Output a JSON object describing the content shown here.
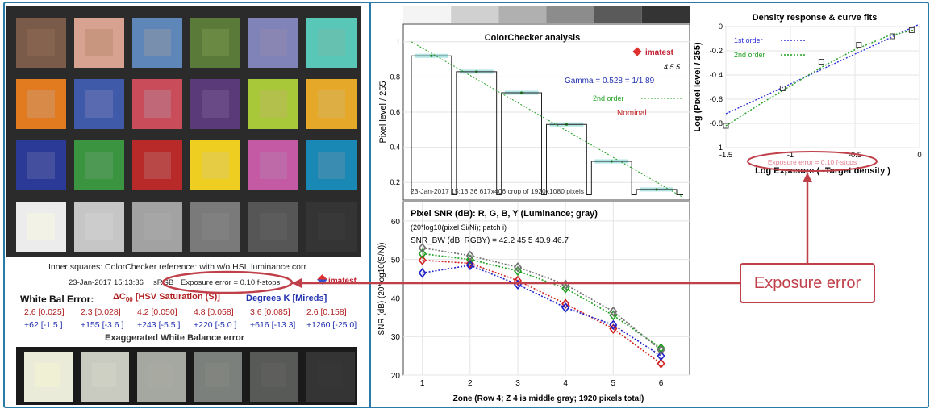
{
  "colors": {
    "accent": "#2a7aa8",
    "callout": "#c0404a",
    "wb_red": "#b02020",
    "wb_blue": "#2030b0"
  },
  "checker": {
    "rows": [
      [
        [
          "#7a5a48",
          "#86634e"
        ],
        [
          "#d7a390",
          "#c8957e"
        ],
        [
          "#5f86b8",
          "#7890ae"
        ],
        [
          "#5a7a3a",
          "#6a8a44"
        ],
        [
          "#7f83b8",
          "#8a86b4"
        ],
        [
          "#58c7b8",
          "#66c1b0"
        ]
      ],
      [
        [
          "#e27a20",
          "#d88a48"
        ],
        [
          "#3e5aa8",
          "#5a6ab0"
        ],
        [
          "#c84c5a",
          "#c06878"
        ],
        [
          "#5a3a78",
          "#6a4a86"
        ],
        [
          "#a8c83a",
          "#b4c04c"
        ],
        [
          "#e6a828",
          "#dcae44"
        ]
      ],
      [
        [
          "#2a3a96",
          "#44509e"
        ],
        [
          "#3a9440",
          "#4e9a54"
        ],
        [
          "#b82a2a",
          "#b84848"
        ],
        [
          "#eece20",
          "#e6cc44"
        ],
        [
          "#c45aa4",
          "#be6aa8"
        ],
        [
          "#1a88b4",
          "#3a8cb0"
        ]
      ],
      [
        [
          "#ececec",
          "#f2f2e6"
        ],
        [
          "#c6c6c6",
          "#cccccc"
        ],
        [
          "#a2a2a2",
          "#a6a6a6"
        ],
        [
          "#7a7a7a",
          "#808080"
        ],
        [
          "#565656",
          "#5c5c5c"
        ],
        [
          "#343434",
          "#383838"
        ]
      ]
    ]
  },
  "left_text": {
    "ref_line": "Inner squares: ColorChecker reference: with w/o HSL luminance corr.",
    "timestamp": "23-Jan-2017 15:13:36",
    "colorspace": "sRGB",
    "exposure_error": "Exposure error = 0.10 f-stops",
    "imatest_logo": "imatest",
    "wb_title": "White Bal Error:",
    "wb_delta": "ΔC",
    "wb_delta_sub": "00",
    "wb_delta_rest": " [HSV Saturation (S)]",
    "wb_degrees": "Degrees K [Mireds]",
    "wb_row1": [
      "2.6 [0.025]",
      "2.3 [0.028]",
      "4.2 [0.050]",
      "4.8 [0.058]",
      "3.6 [0.085]",
      "2.6 [0.158]"
    ],
    "wb_row2": [
      "+62 [-1.5 ]",
      "+155 [-3.6 ]",
      "+243 [-5.5 ]",
      "+220 [-5.0 ]",
      "+616 [-13.3]",
      "+1260 [-25.0]"
    ],
    "exag_title": "Exaggerated White Balance error",
    "exag_patches": [
      [
        "#eaebd8",
        "#f0f0d4"
      ],
      [
        "#c9cbc0",
        "#cfd0c4"
      ],
      [
        "#a4a8a0",
        "#a8aaa2"
      ],
      [
        "#7c807c",
        "#828480"
      ],
      [
        "#585a58",
        "#5e5e5c"
      ],
      [
        "#343434",
        "#363636"
      ]
    ]
  },
  "callout": {
    "label": "Exposure error"
  },
  "chart_data": [
    {
      "type": "line",
      "title": "ColorChecker analysis",
      "ylabel": "Pixel level / 255",
      "xlabel": "",
      "ylim": [
        0.1,
        1.1
      ],
      "yticks": [
        0.2,
        0.4,
        0.6,
        0.8,
        1
      ],
      "gray_steps": [
        0.92,
        0.83,
        0.71,
        0.53,
        0.32,
        0.16
      ],
      "strip_colors": [
        "#f4f4f4",
        "#d0d0d0",
        "#b0b0b0",
        "#8c8c8c",
        "#5a5a5a",
        "#343434"
      ],
      "gamma_label": "Gamma = 0.528 = 1/1.89",
      "order_label": "2nd order",
      "nominal_label": "Nominal",
      "version": "4.5.5",
      "logo": "imatest",
      "footer": "23-Jan-2017 15:13:36    617x406 crop of 1920x1080 pixels"
    },
    {
      "type": "line",
      "title": "Density response & curve fits",
      "xlabel": "Log Exposure ( -Target density )",
      "ylabel": "Log (Pixel level / 255)",
      "xlim": [
        -1.5,
        0
      ],
      "ylim": [
        -1,
        0
      ],
      "xticks": [
        -1.5,
        -1,
        -0.5,
        0
      ],
      "yticks": [
        -1,
        -0.8,
        -0.6,
        -0.4,
        -0.2,
        0
      ],
      "points_x": [
        -1.5,
        -1.06,
        -0.76,
        -0.47,
        -0.21,
        -0.06
      ],
      "points_y": [
        -0.82,
        -0.51,
        -0.29,
        -0.15,
        -0.08,
        -0.03
      ],
      "series": [
        {
          "name": "1st order",
          "color": "#3030d8",
          "x": [
            -1.5,
            0
          ],
          "y": [
            -0.72,
            0.02
          ]
        },
        {
          "name": "2nd order",
          "color": "#20a020",
          "x": [
            -1.5,
            -1.25,
            -1.0,
            -0.75,
            -0.5,
            -0.25,
            -0.05
          ],
          "y": [
            -0.82,
            -0.65,
            -0.49,
            -0.33,
            -0.19,
            -0.08,
            -0.03
          ]
        }
      ],
      "annotation": "Exposure error = 0.10 f-stops"
    },
    {
      "type": "line",
      "title": "Pixel SNR (dB): R, G, B, Y (Luminance; gray)",
      "subtitle": "(20*log10(pixel Si/Ni); patch i)",
      "snr_bw": "SNR_BW (dB; RGBY) = 42.2 45.5 40.9 46.7",
      "xlabel": "Zone (Row 4;  Z 4 is middle gray;  1920 pixels total)",
      "ylabel": "SNR (dB) (20*log10(S/N))",
      "xlim": [
        0.6,
        6.6
      ],
      "ylim": [
        20,
        65
      ],
      "xticks": [
        1,
        2,
        3,
        4,
        5,
        6
      ],
      "yticks": [
        20,
        30,
        40,
        50,
        60
      ],
      "x": [
        1,
        2,
        3,
        4,
        5,
        6
      ],
      "series": [
        {
          "color": "#d02020",
          "values": [
            49.8,
            49.0,
            44.5,
            38.5,
            32.0,
            23.0
          ]
        },
        {
          "color": "#20a020",
          "values": [
            51.5,
            50.0,
            47.0,
            42.5,
            35.5,
            27.0
          ]
        },
        {
          "color": "#2020c8",
          "values": [
            46.5,
            48.5,
            43.5,
            37.5,
            33.0,
            25.0
          ]
        },
        {
          "color": "#707070",
          "values": [
            53.0,
            51.0,
            48.0,
            43.5,
            36.5,
            26.5
          ]
        }
      ]
    }
  ]
}
